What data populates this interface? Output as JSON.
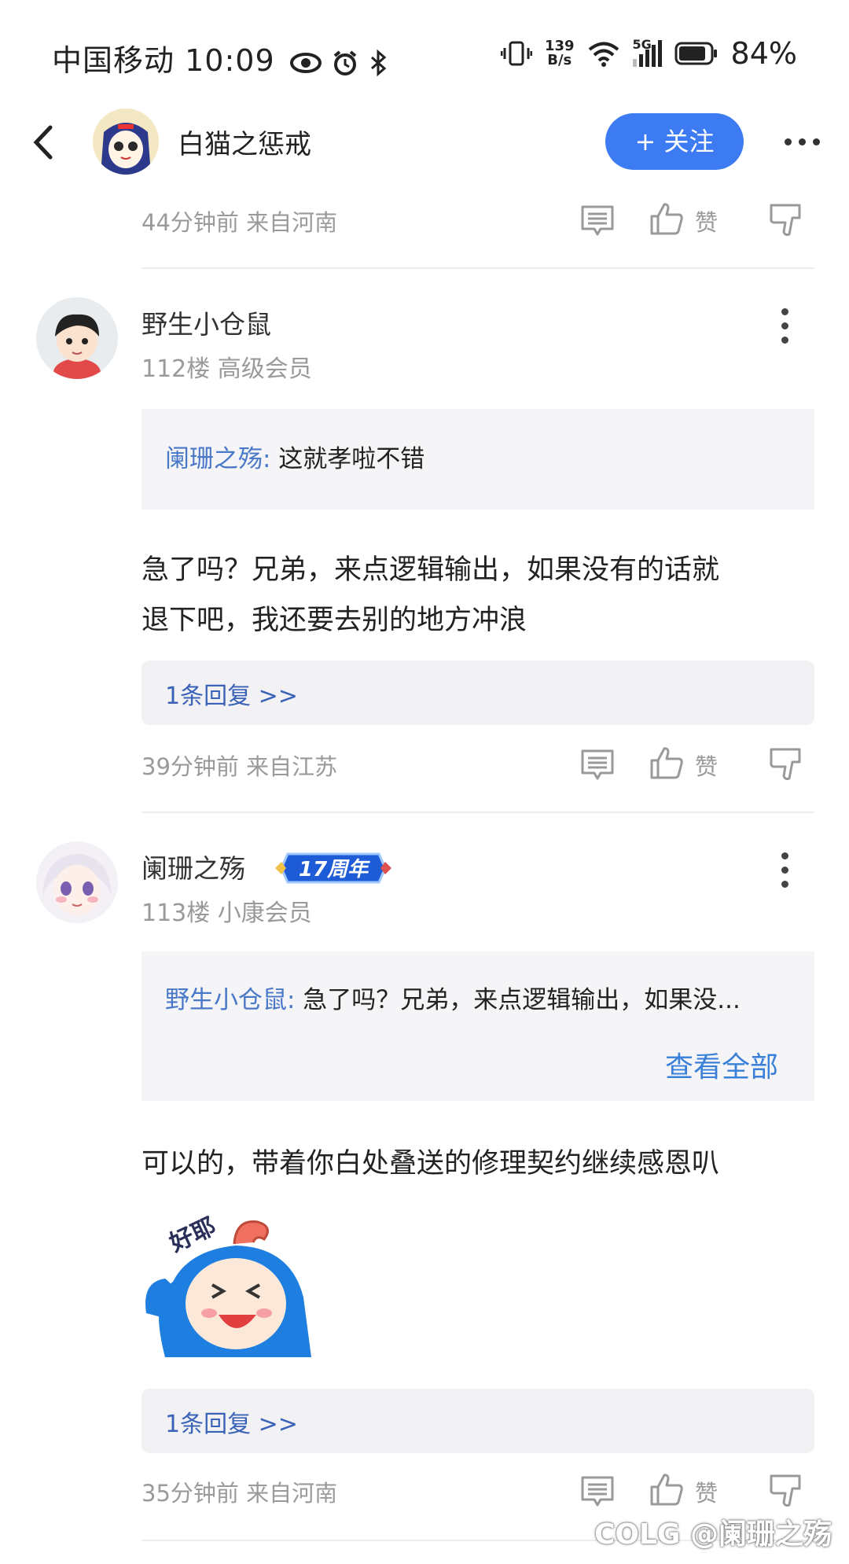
{
  "status_bar": {
    "carrier": "中国移动",
    "time": "10:09",
    "net_speed_top": "139",
    "net_speed_bottom": "B/s",
    "network": "5G",
    "battery": "84%"
  },
  "header": {
    "username": "白猫之惩戒",
    "follow_label": "+ 关注"
  },
  "post_meta_top": {
    "time_location": "44分钟前 来自河南",
    "like_label": "赞"
  },
  "comments": [
    {
      "username": "野生小仓鼠",
      "floor_level": "112楼 高级会员",
      "quote_author": "阑珊之殇:",
      "quote_text": " 这就孝啦不错",
      "content_line1": "急了吗？兄弟，来点逻辑输出，如果没有的话就",
      "content_line2": "退下吧，我还要去别的地方冲浪",
      "reply_count": "1条回复 >>",
      "time_location": "39分钟前 来自江苏",
      "like_label": "赞"
    },
    {
      "username": "阑珊之殇",
      "badge_text": "17周年",
      "floor_level": "113楼 小康会员",
      "quote_author": "野生小仓鼠:",
      "quote_text": " 急了吗？兄弟，来点逻辑输出，如果没...",
      "view_all": "查看全部",
      "content": "可以的，带着你白处叠送的修理契约继续感恩叭",
      "sticker_text": "好耶",
      "reply_count": "1条回复 >>",
      "time_location": "35分钟前 来自河南",
      "like_label": "赞"
    }
  ],
  "watermark": "COLG @阑珊之殇",
  "colors": {
    "accent_blue": "#3d7bf2",
    "link_blue": "#3a63b8",
    "meta_gray": "#9a9a9a"
  }
}
